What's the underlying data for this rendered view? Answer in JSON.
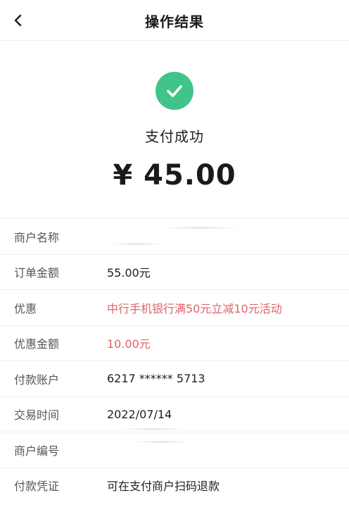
{
  "nav": {
    "title": "操作结果",
    "back_icon": "chevron-left-icon"
  },
  "result": {
    "icon": "check-circle-icon",
    "icon_color": "#41c489",
    "status": "支付成功",
    "amount": "¥ 45.00"
  },
  "details": [
    {
      "label": "商户名称",
      "value": ""
    },
    {
      "label": "订单金额",
      "value": "55.00元"
    },
    {
      "label": "优惠",
      "value": "中行手机银行满50元立减10元活动"
    },
    {
      "label": "优惠金额",
      "value": "10.00元"
    },
    {
      "label": "付款账户",
      "value": "6217 ****** 5713"
    },
    {
      "label": "交易时间",
      "value": "2022/07/14"
    },
    {
      "label": "商户编号",
      "value": ""
    },
    {
      "label": "付款凭证",
      "value": "可在支付商户扫码退款"
    }
  ],
  "colors": {
    "accent_red": "#e0646a",
    "success_green": "#41c489"
  }
}
